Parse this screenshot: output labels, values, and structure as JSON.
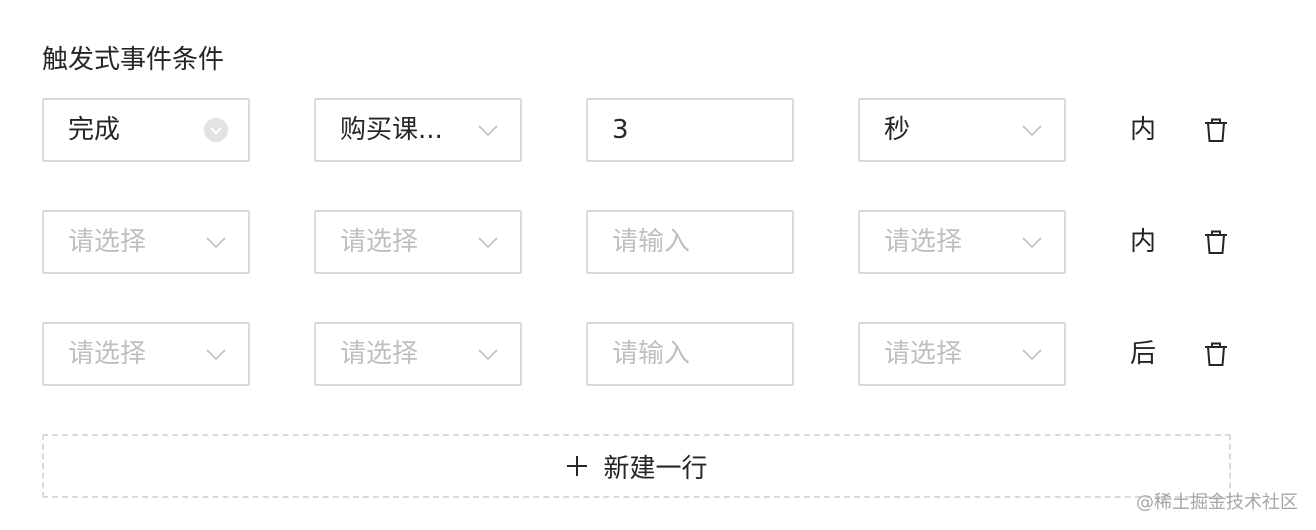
{
  "title": "触发式事件条件",
  "rows": [
    {
      "event": "完成",
      "course": "购买课...",
      "number": "3",
      "unit": "秒",
      "suffix": "内"
    },
    {
      "event_placeholder": "请选择",
      "course_placeholder": "请选择",
      "number_placeholder": "请输入",
      "unit_placeholder": "请选择",
      "suffix": "内"
    },
    {
      "event_placeholder": "请选择",
      "course_placeholder": "请选择",
      "number_placeholder": "请输入",
      "unit_placeholder": "请选择",
      "suffix": "后"
    }
  ],
  "add_row_label": "新建一行",
  "watermark": "@稀土掘金技术社区",
  "icons": {
    "dropdown": "chevron-down-icon",
    "delete": "trash-icon",
    "add": "plus-icon"
  },
  "colors": {
    "border": "#d9d9d9",
    "text": "#262626",
    "placeholder": "#bfbfbf"
  }
}
